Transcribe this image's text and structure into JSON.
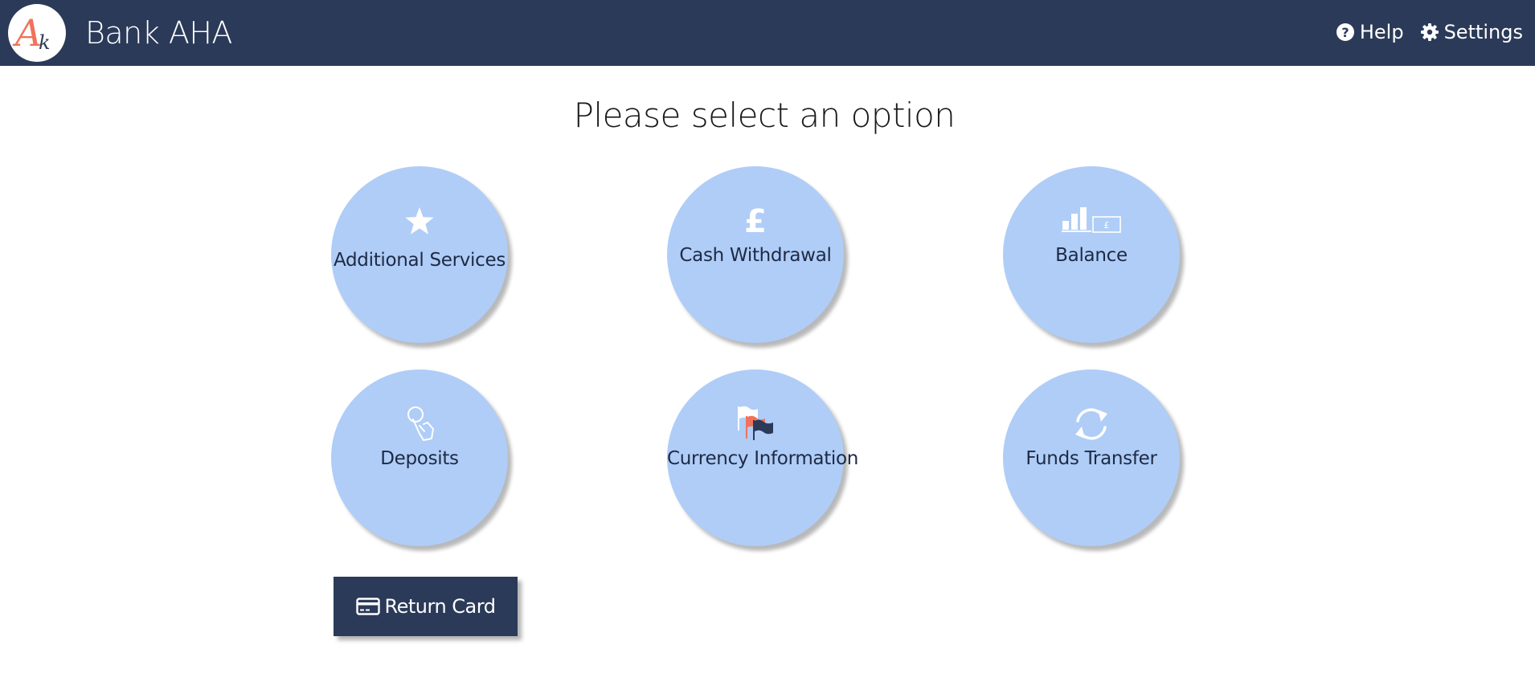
{
  "header": {
    "logo_text": "Ak",
    "title": "Bank AHA",
    "help_label": "Help",
    "settings_label": "Settings",
    "help_icon": "question-circle-icon",
    "settings_icon": "gear-icon"
  },
  "main": {
    "title": "Please select an option",
    "options": [
      {
        "label": "Additional Services",
        "icon": "star-icon"
      },
      {
        "label": "Cash Withdrawal",
        "icon": "pound-sign-icon"
      },
      {
        "label": "Balance",
        "icon": "bar-chart-banknote-icon"
      },
      {
        "label": "Deposits",
        "icon": "hand-coin-icon"
      },
      {
        "label": "Currency Information",
        "icon": "flags-icon"
      },
      {
        "label": "Funds Transfer",
        "icon": "refresh-arrows-icon"
      }
    ],
    "return_card_label": "Return Card",
    "return_card_icon": "credit-card-icon"
  },
  "colors": {
    "header_bg": "#2b3a58",
    "option_bg": "#afcdf7",
    "logo_accent": "#f0725a",
    "text_dark": "#1e2a44"
  }
}
